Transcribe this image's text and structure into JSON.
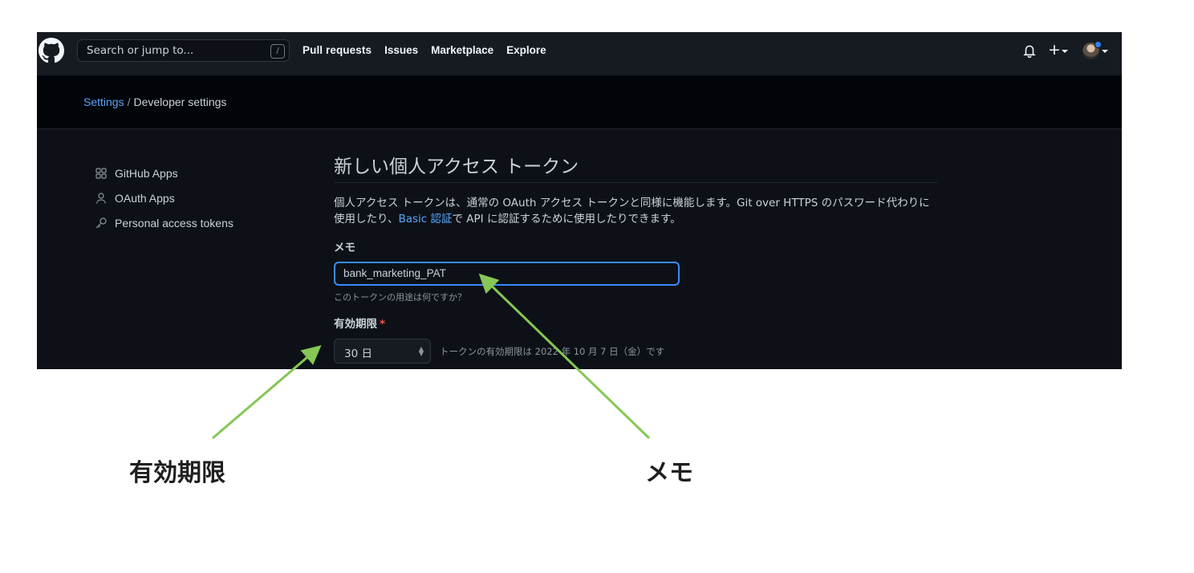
{
  "topbar": {
    "search_placeholder": "Search or jump to...",
    "search_shortcut": "/",
    "nav": [
      "Pull requests",
      "Issues",
      "Marketplace",
      "Explore"
    ],
    "plus": "+"
  },
  "breadcrumb": {
    "parent": "Settings",
    "separator": "/",
    "current": "Developer settings"
  },
  "sidebar": {
    "items": [
      {
        "label": "GitHub Apps",
        "icon": "apps-icon"
      },
      {
        "label": "OAuth Apps",
        "icon": "person-icon"
      },
      {
        "label": "Personal access tokens",
        "icon": "key-icon"
      }
    ]
  },
  "main": {
    "title": "新しい個人アクセス トークン",
    "desc_line1": "個人アクセス トークンは、通常の OAuth アクセス トークンと同様に機能します。Git over HTTPS のパスワード代わりに",
    "desc_line2_pre": "使用したり、",
    "desc_link": "Basic 認証",
    "desc_line2_post": "で API に認証するために使用したりできます。",
    "memo_label": "メモ",
    "memo_value": "bank_marketing_PAT",
    "memo_hint": "このトークンの用途は何ですか？",
    "expiration_label": "有効期限",
    "required_mark": "*",
    "expiration_value": "30 日",
    "expiration_note": "トークンの有効期限は 2022 年 10 月 7 日（金）です"
  },
  "annotations": {
    "expiration": "有効期限",
    "memo": "メモ",
    "arrow_color": "#86c755"
  }
}
